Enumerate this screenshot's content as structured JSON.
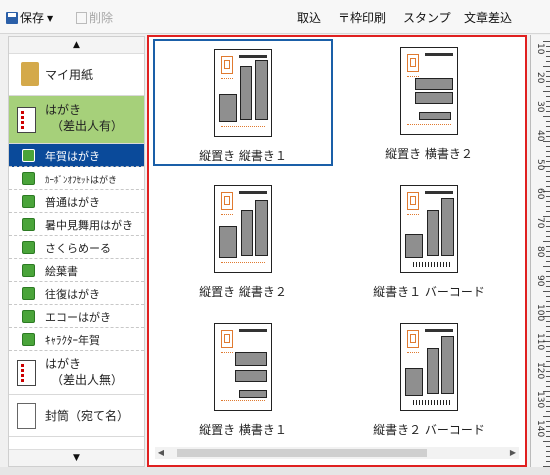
{
  "toolbar": {
    "save_label": "保存",
    "delete_label": "削除",
    "import_label": "取込",
    "frame_print_label": "〒枠印刷",
    "stamp_label": "スタンプ",
    "text_insert_label": "文章差込"
  },
  "sidebar": {
    "up_arrow": "▲",
    "down_arrow": "▼",
    "categories": [
      {
        "label": "マイ用紙"
      },
      {
        "label_line1": "はがき",
        "label_line2": "（差出人有）"
      },
      {
        "label_line1": "はがき",
        "label_line2": "（差出人無）"
      },
      {
        "label": "封筒（宛て名）"
      }
    ],
    "items": [
      {
        "label": "年賀はがき",
        "selected": true
      },
      {
        "label": "ｶｰﾎﾞﾝｵﾌｾｯﾄはがき"
      },
      {
        "label": "普通はがき"
      },
      {
        "label": "暑中見舞用はがき"
      },
      {
        "label": "さくらめーる"
      },
      {
        "label": "絵葉書"
      },
      {
        "label": "往復はがき"
      },
      {
        "label": "エコーはがき"
      },
      {
        "label": "ｷｬﾗｸﾀｰ年賀"
      }
    ]
  },
  "templates": [
    {
      "caption": "縦置き 縦書き１",
      "selected": true
    },
    {
      "caption": "縦置き 横書き２"
    },
    {
      "caption": "縦置き 縦書き２"
    },
    {
      "caption": "縦書き１ バーコード"
    },
    {
      "caption": "縦置き 横書き１"
    },
    {
      "caption": "縦書き２ バーコード"
    }
  ],
  "ruler_labels": [
    "10",
    "20",
    "30",
    "40",
    "50",
    "60",
    "70",
    "80",
    "90",
    "100",
    "110",
    "120",
    "130",
    "140"
  ],
  "colors": {
    "selection": "#0a4a9a",
    "highlight_border": "#e02020",
    "green_item": "#4aa43a",
    "category_selected": "#a6d07a"
  }
}
